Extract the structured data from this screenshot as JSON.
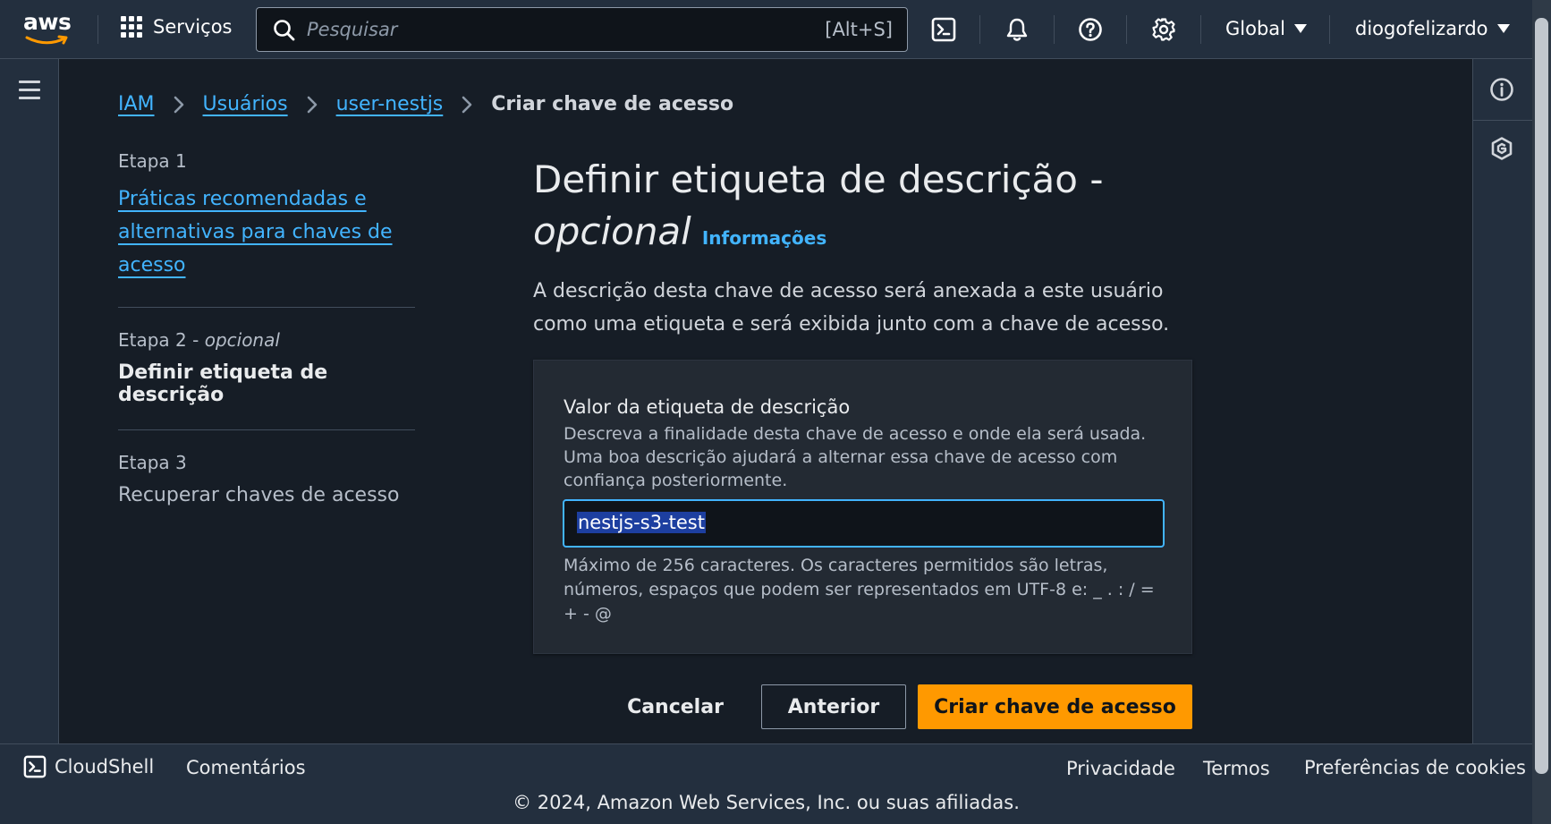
{
  "nav": {
    "logo_text": "aws",
    "services_label": "Serviços",
    "search_placeholder": "Pesquisar",
    "search_shortcut": "[Alt+S]",
    "region_label": "Global",
    "account_label": "diogofelizardo",
    "icons": [
      "cloudshell-icon",
      "notifications-bell-icon",
      "help-icon",
      "settings-gear-icon"
    ]
  },
  "breadcrumb": {
    "items": [
      "IAM",
      "Usuários",
      "user-nestjs"
    ],
    "current": "Criar chave de acesso"
  },
  "steps": [
    {
      "label": "Etapa 1",
      "title": "Práticas recomendadas e alternativas para chaves de acesso"
    },
    {
      "label": "Etapa 2 - ",
      "label_optional": "opcional",
      "title": "Definir etiqueta de descrição"
    },
    {
      "label": "Etapa 3",
      "title": "Recuperar chaves de acesso"
    }
  ],
  "main": {
    "title": "Definir etiqueta de descrição -",
    "title_optional": "opcional",
    "info_link": "Informações",
    "description": "A descrição desta chave de acesso será anexada a este usuário como uma etiqueta e será exibida junto com a chave de acesso."
  },
  "form": {
    "field_label": "Valor da etiqueta de descrição",
    "field_description": "Descreva a finalidade desta chave de acesso e onde ela será usada. Uma boa descrição ajudará a alternar essa chave de acesso com confiança posteriormente.",
    "field_value": "nestjs-s3-test",
    "constraint": "Máximo de 256 caracteres. Os caracteres permitidos são letras, números, espaços que podem ser representados em UTF-8 e: _ . : / = + - @"
  },
  "actions": {
    "cancel": "Cancelar",
    "previous": "Anterior",
    "create": "Criar chave de acesso"
  },
  "footer": {
    "cloudshell": "CloudShell",
    "feedback": "Comentários",
    "privacy": "Privacidade",
    "terms": "Termos",
    "cookies": "Preferências de cookies",
    "copyright": "© 2024, Amazon Web Services, Inc. ou suas afiliadas."
  },
  "colors": {
    "link": "#42b4ff",
    "primary": "#ff9900",
    "nav_bg": "#232f3e",
    "page_bg": "#161d26"
  }
}
